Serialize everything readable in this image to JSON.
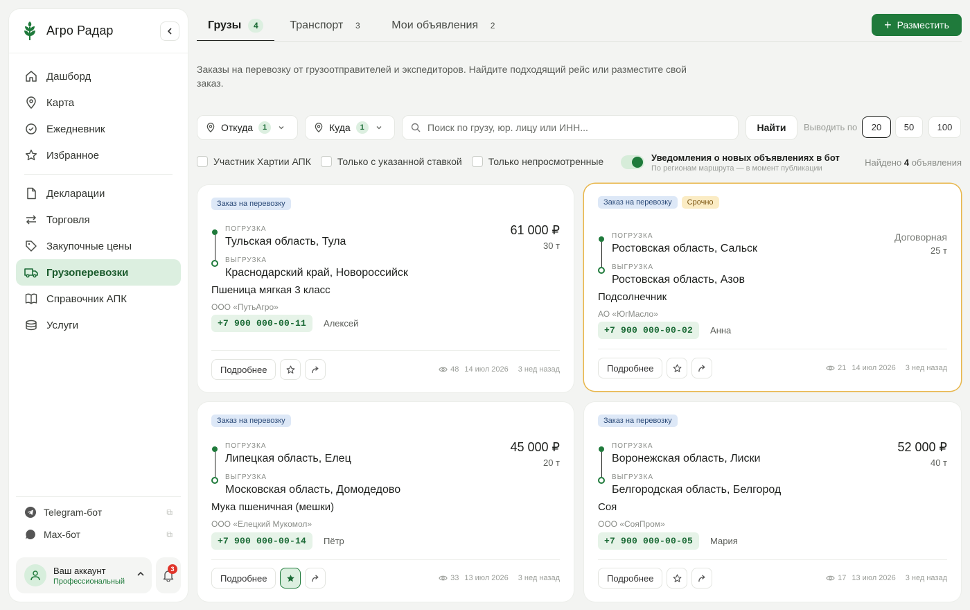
{
  "brand": {
    "name": "Агро Радар"
  },
  "nav": {
    "group1": [
      {
        "label": "Дашборд",
        "icon": "home-icon"
      },
      {
        "label": "Карта",
        "icon": "map-pin-icon"
      },
      {
        "label": "Ежедневник",
        "icon": "check-circle-icon"
      },
      {
        "label": "Избранное",
        "icon": "star-icon"
      }
    ],
    "group2": [
      {
        "label": "Декларации",
        "icon": "document-icon"
      },
      {
        "label": "Торговля",
        "icon": "arrows-icon"
      },
      {
        "label": "Закупочные цены",
        "icon": "tag-icon"
      },
      {
        "label": "Грузоперевозки",
        "icon": "truck-icon",
        "active": true
      },
      {
        "label": "Справочник АПК",
        "icon": "book-icon"
      },
      {
        "label": "Услуги",
        "icon": "box-icon"
      }
    ]
  },
  "side_links": [
    {
      "label": "Telegram-бот",
      "icon": "telegram-icon"
    },
    {
      "label": "Max-бот",
      "icon": "chat-icon"
    }
  ],
  "account": {
    "name": "Ваш аккаунт",
    "plan": "Профессиональный",
    "notifications": "3"
  },
  "tabs": [
    {
      "label": "Грузы",
      "count": "4",
      "active": true
    },
    {
      "label": "Транспорт",
      "count": "3"
    },
    {
      "label": "Мои объявления",
      "count": "2"
    }
  ],
  "post_button": "Разместить",
  "description": "Заказы на перевозку от грузоотправителей и экспедиторов. Найдите подходящий рейс или разместите свой заказ.",
  "filters": {
    "from_label": "Откуда",
    "from_count": "1",
    "to_label": "Куда",
    "to_count": "1",
    "search_placeholder": "Поиск по грузу, юр. лицу или ИНН...",
    "find": "Найти",
    "perpage_label": "Выводить по",
    "perpage": [
      "20",
      "50",
      "100"
    ],
    "perpage_selected": "20"
  },
  "checkboxes": [
    "Участник Хартии АПК",
    "Только с указанной ставкой",
    "Только непросмотренные"
  ],
  "notify": {
    "title": "Уведомления о новых объявлениях в бот",
    "subtitle": "По регионам маршрута — в момент публикации",
    "enabled": true
  },
  "found": {
    "prefix": "Найдено",
    "count": "4",
    "suffix": "объявления"
  },
  "labels": {
    "load": "ПОГРУЗКА",
    "unload": "ВЫГРУЗКА",
    "more": "Подробнее",
    "order_tag": "Заказ на перевозку",
    "urgent_tag": "Срочно"
  },
  "cards": [
    {
      "from": "Тульская область, Тула",
      "to": "Краснодарский край, Новороссийск",
      "cargo": "Пшеница мягкая 3 класс",
      "company": "ООО «ПутьАгро»",
      "phone": "+7 900 000-00-11",
      "contact": "Алексей",
      "price": "61 000 ₽",
      "tons": "30 т",
      "views": "48",
      "date": "14 июл 2026",
      "ago": "3 нед назад",
      "favorite": false,
      "urgent": false
    },
    {
      "from": "Ростовская область, Сальск",
      "to": "Ростовская область, Азов",
      "cargo": "Подсолнечник",
      "company": "АО «ЮгМасло»",
      "phone": "+7 900 000-00-02",
      "contact": "Анна",
      "price": "Договорная",
      "tons": "25 т",
      "views": "21",
      "date": "14 июл 2026",
      "ago": "3 нед назад",
      "favorite": false,
      "urgent": true
    },
    {
      "from": "Липецкая область, Елец",
      "to": "Московская область, Домодедово",
      "cargo": "Мука пшеничная (мешки)",
      "company": "ООО «Елецкий Мукомол»",
      "phone": "+7 900 000-00-14",
      "contact": "Пётр",
      "price": "45 000 ₽",
      "tons": "20 т",
      "views": "33",
      "date": "13 июл 2026",
      "ago": "3 нед назад",
      "favorite": true,
      "urgent": false
    },
    {
      "from": "Воронежская область, Лиски",
      "to": "Белгородская область, Белгород",
      "cargo": "Соя",
      "company": "ООО «СояПром»",
      "phone": "+7 900 000-00-05",
      "contact": "Мария",
      "price": "52 000 ₽",
      "tons": "40 т",
      "views": "17",
      "date": "13 июл 2026",
      "ago": "3 нед назад",
      "favorite": false,
      "urgent": false
    }
  ],
  "colors": {
    "accent": "#1f7a3b",
    "accent_light": "#dcefe0",
    "urgent_border": "#e8b64a"
  }
}
